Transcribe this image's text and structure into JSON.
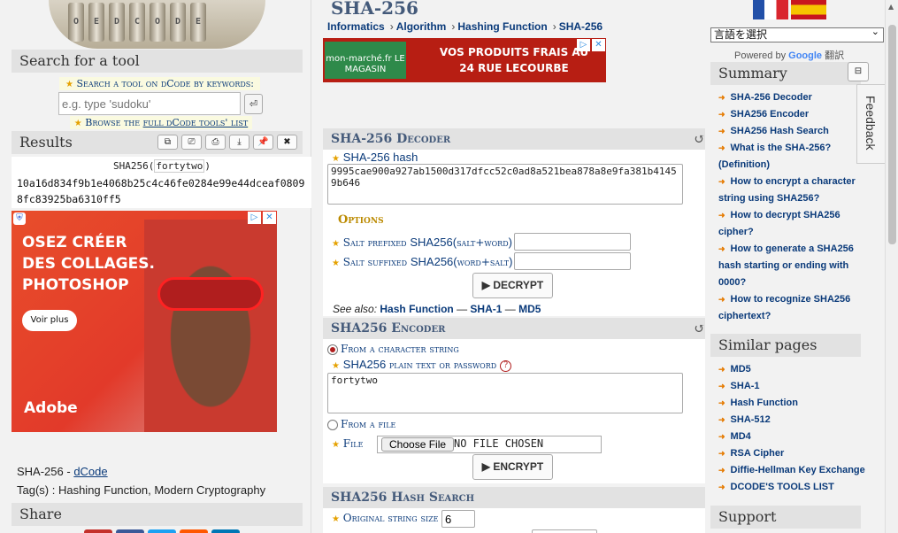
{
  "left": {
    "search_title": "Search for a tool",
    "search_tip": "Search a tool on dCode by keywords:",
    "search_placeholder": "e.g. type 'sudoku'",
    "search_go": "⏎",
    "browse_prefix": "Browse the ",
    "browse_link": "full dCode tools' list",
    "results_title": "Results",
    "result_buttons": [
      "⧉",
      "⎚",
      "⎙",
      "⤓",
      "📌",
      "✖"
    ],
    "result_caption_prefix": "SHA256(",
    "result_caption_kw": "fortytwo",
    "result_caption_suffix": ")",
    "result_value": "10a16d834f9b1e4068b25c4c46fe0284e99e44dceaf08098fc83925ba6310ff5",
    "ad": {
      "text": "OSEZ CRÉER DES COLLAGES. PHOTOSHOP",
      "cta": "Voir plus",
      "brand": "Adobe"
    },
    "meta_prefix": "SHA-256 - ",
    "meta_link": "dCode",
    "tags": "Tag(s) : Hashing Function, Modern Cryptography",
    "share_title": "Share"
  },
  "center": {
    "title": "SHA-256",
    "breadcrumbs": [
      "Informatics",
      "Algorithm",
      "Hashing Function",
      "SHA-256"
    ],
    "ad_top": {
      "brand": "mon-marché.fr LE MAGASIN",
      "text": "VOS PRODUITS FRAIS AU 24 RUE LECOURBE"
    },
    "decoder": {
      "title": "SHA-256 Decoder",
      "hash_label": "SHA-256 hash",
      "hash_value": "9995cae900a927ab1500d317dfcc52c0ad8a521bea878a8e9fa381b41459b646",
      "options_title": "Options",
      "salt_prefixed_label_a": "Salt prefixed ",
      "salt_prefixed_label_b": "SHA256(",
      "salt_prefixed_label_c": "salt+word",
      "salt_prefixed_label_d": ")",
      "salt_suffixed_label_a": "Salt suffixed ",
      "salt_suffixed_label_b": "SHA256(",
      "salt_suffixed_label_c": "word+salt",
      "salt_suffixed_label_d": ")",
      "decrypt_btn": "▶ DECRYPT",
      "see_also_label": "See also:",
      "see_also": [
        "Hash Function",
        "SHA-1",
        "MD5"
      ],
      "dash": " — "
    },
    "encoder": {
      "title": "SHA256 Encoder",
      "from_string": "From a character string",
      "plain_label_a": "SHA256 ",
      "plain_label_b": "plain text or password",
      "help": "?",
      "plain_value": "fortytwo",
      "from_file": "From a file",
      "file_label": "File",
      "file_btn": "Choose File",
      "file_none": "NO FILE CHOSEN",
      "encrypt_btn": "▶ ENCRYPT"
    },
    "hash_search": {
      "title": "SHA256 Hash Search",
      "size_label": "Original string size",
      "size_value": "6"
    }
  },
  "right": {
    "lang_select": "言語を選択",
    "powered_prefix": "Powered by ",
    "powered_brand": "Google",
    "powered_suffix": " 翻訳",
    "summary_title": "Summary",
    "collapse": "⊟",
    "summary": [
      "SHA-256 Decoder",
      "SHA256 Encoder",
      "SHA256 Hash Search",
      "What is the SHA-256?",
      "(Definition)",
      "How to encrypt a character",
      "string using SHA256?",
      "How to decrypt SHA256",
      "cipher?",
      "How to generate a SHA256",
      "hash starting or ending with",
      "0000?",
      "How to recognize SHA256",
      "ciphertext?"
    ],
    "similar_title": "Similar pages",
    "similar": [
      "MD5",
      "SHA-1",
      "Hash Function",
      "SHA-512",
      "MD4",
      "RSA Cipher",
      "Diffie-Hellman Key Exchange",
      "DCODE'S TOOLS LIST"
    ],
    "support_title": "Support",
    "feedback": "Feedback"
  }
}
